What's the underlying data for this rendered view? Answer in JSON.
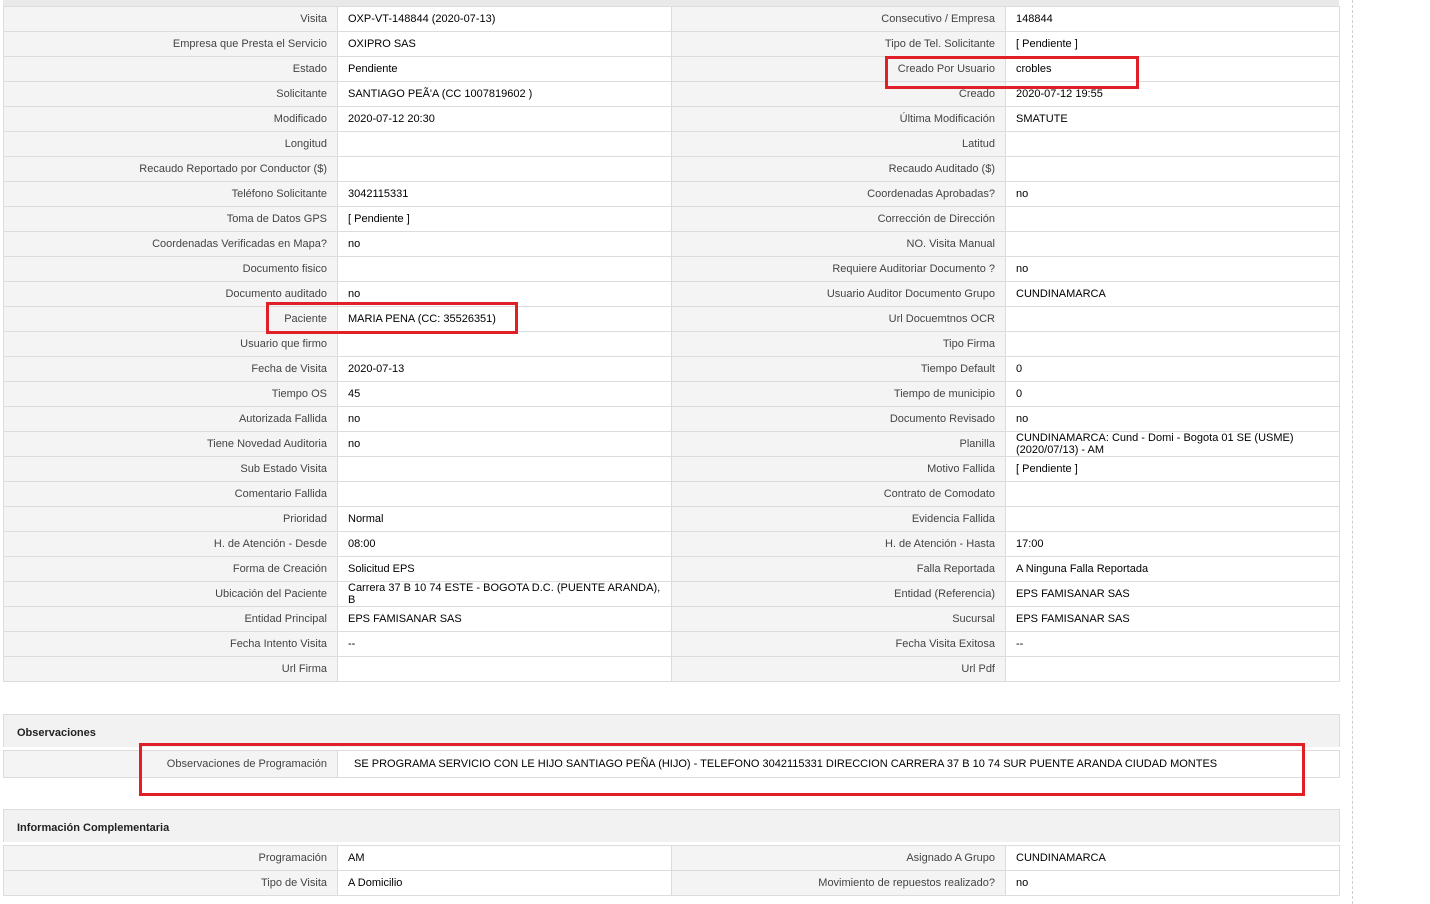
{
  "main_rows": [
    {
      "l1": "Visita",
      "v1": "OXP-VT-148844 (2020-07-13)",
      "l2": "Consecutivo / Empresa",
      "v2": "148844"
    },
    {
      "l1": "Empresa que Presta el Servicio",
      "v1": "OXIPRO SAS",
      "l2": "Tipo de Tel. Solicitante",
      "v2": "[ Pendiente ]"
    },
    {
      "l1": "Estado",
      "v1": "Pendiente",
      "l2": "Creado Por Usuario",
      "v2": "crobles"
    },
    {
      "l1": "Solicitante",
      "v1": "SANTIAGO PEÃ'A (CC 1007819602 )",
      "l2": "Creado",
      "v2": "2020-07-12 19:55"
    },
    {
      "l1": "Modificado",
      "v1": "2020-07-12 20:30",
      "l2": "Última Modificación",
      "v2": " SMATUTE"
    },
    {
      "l1": "Longitud",
      "v1": "",
      "l2": "Latitud",
      "v2": ""
    },
    {
      "l1": "Recaudo Reportado por Conductor ($)",
      "v1": "",
      "l2": "Recaudo Auditado ($)",
      "v2": ""
    },
    {
      "l1": "Teléfono Solicitante",
      "v1": "3042115331",
      "l2": "Coordenadas Aprobadas?",
      "v2": " no"
    },
    {
      "l1": "Toma de Datos GPS",
      "v1": "[ Pendiente ]",
      "l2": "Corrección de Dirección",
      "v2": ""
    },
    {
      "l1": "Coordenadas Verificadas en Mapa?",
      "v1": " no",
      "l2": "NO. Visita Manual",
      "v2": ""
    },
    {
      "l1": "Documento fisico",
      "v1": "",
      "l2": "Requiere Auditoriar Documento ?",
      "v2": " no"
    },
    {
      "l1": "Documento auditado",
      "v1": " no",
      "l2": "Usuario Auditor Documento Grupo",
      "v2": "CUNDINAMARCA"
    },
    {
      "l1": "Paciente",
      "v1": "MARIA PENA (CC: 35526351)",
      "l2": "Url Docuemtnos OCR",
      "v2": ""
    },
    {
      "l1": "Usuario que firmo",
      "v1": "",
      "l2": "Tipo Firma",
      "v2": ""
    },
    {
      "l1": "Fecha de Visita",
      "v1": " 2020-07-13",
      "l2": "Tiempo Default",
      "v2": "0"
    },
    {
      "l1": "Tiempo OS",
      "v1": "45",
      "l2": "Tiempo de municipio",
      "v2": "0"
    },
    {
      "l1": "Autorizada Fallida",
      "v1": " no",
      "l2": "Documento Revisado",
      "v2": " no"
    },
    {
      "l1": "Tiene Novedad Auditoria",
      "v1": " no",
      "l2": "Planilla",
      "v2": "CUNDINAMARCA: Cund - Domi - Bogota 01 SE (USME) (2020/07/13) - AM"
    },
    {
      "l1": "Sub Estado Visita",
      "v1": "",
      "l2": "Motivo Fallida",
      "v2": "[ Pendiente ]"
    },
    {
      "l1": "Comentario Fallida",
      "v1": "",
      "l2": "Contrato de Comodato",
      "v2": ""
    },
    {
      "l1": "Prioridad",
      "v1": "Normal",
      "l2": "Evidencia Fallida",
      "v2": ""
    },
    {
      "l1": "H. de Atención - Desde",
      "v1": "08:00",
      "l2": "H. de Atención - Hasta",
      "v2": "17:00"
    },
    {
      "l1": "Forma de Creación",
      "v1": "Solicitud EPS",
      "l2": "Falla Reportada",
      "v2": "A Ninguna Falla Reportada"
    },
    {
      "l1": "Ubicación del Paciente",
      "v1": "Carrera 37 B 10 74 ESTE - BOGOTA D.C. (PUENTE ARANDA), B",
      "l2": "Entidad (Referencia)",
      "v2": "EPS FAMISANAR SAS"
    },
    {
      "l1": "Entidad Principal",
      "v1": "EPS FAMISANAR SAS",
      "l2": "Sucursal",
      "v2": "EPS FAMISANAR SAS"
    },
    {
      "l1": "Fecha Intento Visita",
      "v1": " --",
      "l2": "Fecha Visita Exitosa",
      "v2": " --"
    },
    {
      "l1": "Url Firma",
      "v1": "",
      "l2": "Url Pdf",
      "v2": ""
    }
  ],
  "observaciones": {
    "title": "Observaciones",
    "label": "Observaciones de Programación",
    "value": "SE PROGRAMA SERVICIO CON LE HIJO SANTIAGO PEÑA (HIJO) - TELEFONO 3042115331 DIRECCION CARRERA 37 B 10 74 SUR PUENTE ARANDA CIUDAD MONTES"
  },
  "complementaria": {
    "title": "Información Complementaria",
    "rows": [
      {
        "l1": "Programación",
        "v1": "AM",
        "l2": "Asignado A Grupo",
        "v2": "CUNDINAMARCA"
      },
      {
        "l1": "Tipo de Visita",
        "v1": "A Domicilio",
        "l2": "Movimiento de repuestos realizado?",
        "v2": " no"
      }
    ]
  },
  "colors": {
    "highlight": "#e01f27",
    "label_bg": "#f4f4f4",
    "border": "#dcdcdc"
  }
}
